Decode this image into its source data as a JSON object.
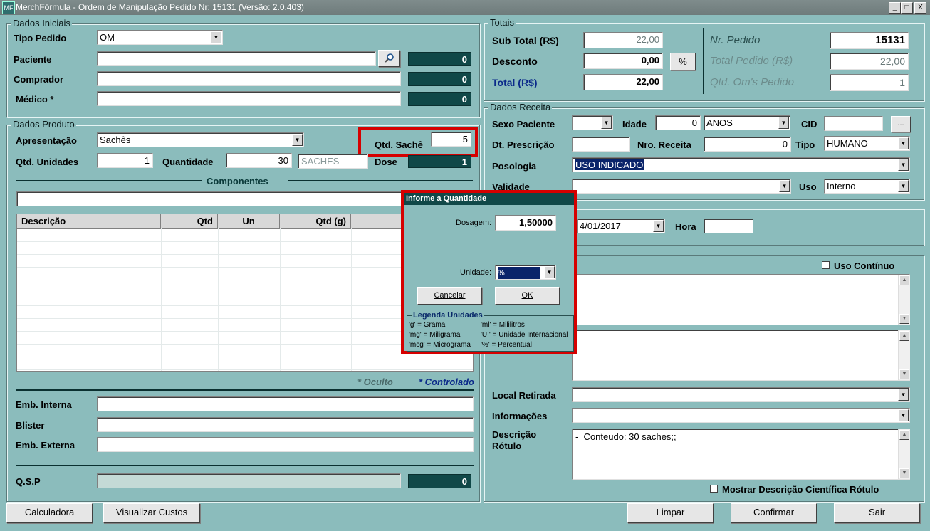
{
  "window": {
    "title": "MerchFórmula - Ordem de Manipulação Pedido Nr: 15131 (Versão: 2.0.403)",
    "icon_name": "app-icon",
    "controls": [
      "_",
      "□",
      "X"
    ]
  },
  "dados_iniciais": {
    "title": "Dados Iniciais",
    "tipo_pedido_label": "Tipo Pedido",
    "tipo_pedido_value": "OM",
    "paciente_label": "Paciente",
    "paciente_value": "",
    "paciente_count": "0",
    "comprador_label": "Comprador",
    "comprador_value": "",
    "comprador_count": "0",
    "medico_label": "Médico *",
    "medico_value": "",
    "medico_count": "0"
  },
  "dados_produto": {
    "title": "Dados Produto",
    "apresentacao_label": "Apresentação",
    "apresentacao_value": "Sachês",
    "qtd_sache_label": "Qtd. Sachê",
    "qtd_sache_value": "5",
    "qtd_unidades_label": "Qtd. Unidades",
    "qtd_unidades_value": "1",
    "quantidade_label": "Quantidade",
    "quantidade_value": "30",
    "quantidade_unit": "SACHES",
    "dose_label": "Dose",
    "dose_value": "1",
    "componentes_label": "Componentes",
    "componentes_search": "",
    "table_headers": [
      "Descrição",
      "Qtd",
      "Un",
      "Qtd (g)"
    ],
    "oculto_label": "* Oculto",
    "controlado_label": "* Controlado",
    "emb_interna_label": "Emb. Interna",
    "emb_interna_value": "",
    "blister_label": "Blister",
    "blister_value": "",
    "emb_externa_label": "Emb. Externa",
    "emb_externa_value": "",
    "qsp_label": "Q.S.P",
    "qsp_value": "",
    "qsp_count": "0"
  },
  "totais": {
    "title": "Totais",
    "sub_total_label": "Sub Total (R$)",
    "sub_total_value": "22,00",
    "desconto_label": "Desconto",
    "desconto_value": "0,00",
    "percent_button": "%",
    "total_label": "Total (R$)",
    "total_value": "22,00",
    "nr_pedido_label": "Nr. Pedido",
    "nr_pedido_value": "15131",
    "total_pedido_label": "Total Pedido (R$)",
    "total_pedido_value": "22,00",
    "qtd_oms_label": "Qtd. Om's Pedido",
    "qtd_oms_value": "1"
  },
  "dados_receita": {
    "title": "Dados Receita",
    "sexo_label": "Sexo Paciente",
    "sexo_value": "",
    "idade_label": "Idade",
    "idade_value": "0",
    "idade_unit": "ANOS",
    "cid_label": "CID",
    "cid_value": "",
    "cid_button": "...",
    "dt_prescricao_label": "Dt. Prescrição",
    "dt_prescricao_value": "",
    "nro_receita_label": "Nro. Receita",
    "nro_receita_value": "0",
    "tipo_label": "Tipo",
    "tipo_value": "HUMANO",
    "posologia_label": "Posologia",
    "posologia_value": "USO INDICADO",
    "validade_label": "Validade",
    "validade_value": "",
    "uso_label": "Uso",
    "uso_value": "Interno"
  },
  "entrega": {
    "date_value": "4/01/2017",
    "hora_label": "Hora",
    "hora_value": ""
  },
  "observacoes": {
    "uso_continuo_label": "Uso Contínuo",
    "local_retirada_label": "Local Retirada",
    "local_retirada_value": "",
    "informacoes_label": "Informações",
    "informacoes_value": "",
    "descricao_rotulo_label_1": "Descrição",
    "descricao_rotulo_label_2": "Rótulo",
    "descricao_rotulo_value": "-  Conteudo: 30 saches;;",
    "mostrar_label": "Mostrar Descrição Científica Rótulo"
  },
  "dialog": {
    "title": "Informe a Quantidade",
    "dosagem_label": "Dosagem:",
    "dosagem_value": "1,50000",
    "unidade_label": "Unidade:",
    "unidade_value": "%",
    "cancel_label": "Cancelar",
    "ok_label": "OK",
    "legenda_title": "Legenda Unidades",
    "legend": [
      [
        "'g' = Grama",
        "'ml' = Mililitros"
      ],
      [
        "'mg' = Miligrama",
        "'UI' = Unidade Internacional"
      ],
      [
        "'mcg' = Micrograma",
        "'%' = Percentual"
      ]
    ]
  },
  "footer": {
    "calculadora": "Calculadora",
    "visualizar_custos": "Visualizar Custos",
    "limpar": "Limpar",
    "confirmar": "Confirmar",
    "sair": "Sair"
  },
  "colors": {
    "background": "#8bbcbc",
    "dark_field": "#104848",
    "highlight_red": "#d60000",
    "selection": "#0a246a"
  }
}
